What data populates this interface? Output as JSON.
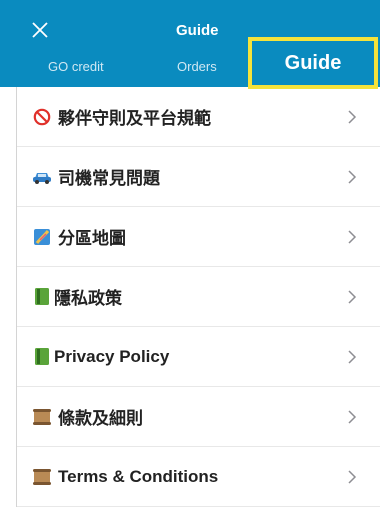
{
  "header": {
    "title": "Guide",
    "tabs": [
      {
        "label": "GO credit"
      },
      {
        "label": "Orders"
      }
    ],
    "highlight_label": "Guide"
  },
  "list": {
    "items": [
      {
        "label": "夥伴守則及平台規範",
        "icon": "prohibited-icon"
      },
      {
        "label": "司機常見問題",
        "icon": "car-icon"
      },
      {
        "label": "分區地圖",
        "icon": "map-icon"
      },
      {
        "label": "隱私政策",
        "icon": "book-icon"
      },
      {
        "label": "Privacy Policy",
        "icon": "book-icon"
      },
      {
        "label": "條款及細則",
        "icon": "scroll-icon"
      },
      {
        "label": "Terms & Conditions",
        "icon": "scroll-icon"
      }
    ]
  },
  "colors": {
    "header_bg": "#0a8bbf",
    "highlight_border": "#f5e33b"
  }
}
